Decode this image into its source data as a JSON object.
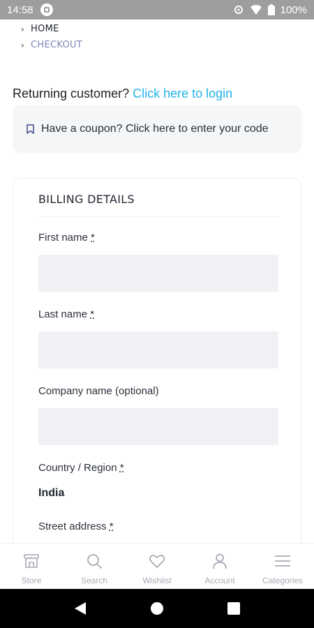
{
  "status_bar": {
    "time": "14:58",
    "battery": "100%"
  },
  "breadcrumb": {
    "items": [
      "HOME",
      "CHECKOUT"
    ]
  },
  "returning": {
    "text": "Returning customer? ",
    "link": "Click here to login"
  },
  "coupon": {
    "text": "Have a coupon? Click here to enter your code"
  },
  "billing": {
    "title": "BILLING DETAILS",
    "first_name_label": "First name ",
    "last_name_label": "Last name ",
    "company_label": "Company name (optional)",
    "country_label": "Country / Region ",
    "country_value": "India",
    "street_label": "Street address ",
    "required_mark": "*",
    "first_name_value": "",
    "last_name_value": "",
    "company_value": ""
  },
  "bottom_nav": {
    "items": [
      {
        "label": "Store",
        "icon": "store-icon"
      },
      {
        "label": "Search",
        "icon": "search-icon"
      },
      {
        "label": "Wishlist",
        "icon": "heart-icon"
      },
      {
        "label": "Account",
        "icon": "user-icon"
      },
      {
        "label": "Categories",
        "icon": "menu-icon"
      }
    ]
  },
  "colors": {
    "link": "#23b4e8",
    "breadcrumb_current": "#7b86b5",
    "input_bg": "#eff1f4",
    "nav_inactive": "#a7abb3"
  }
}
